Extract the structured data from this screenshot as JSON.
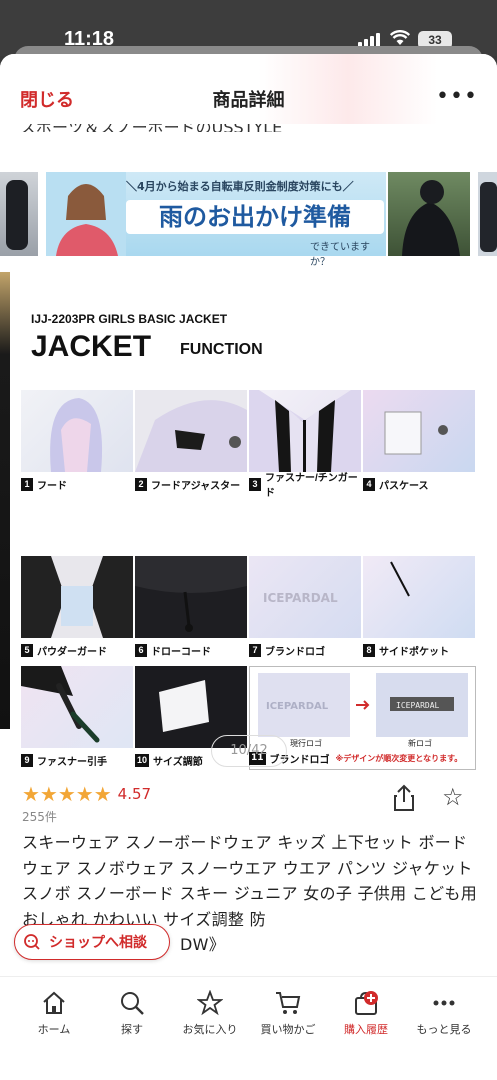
{
  "status": {
    "time": "11:18",
    "battery": "33"
  },
  "header": {
    "close": "閉じる",
    "title": "商品詳細",
    "more": "•••"
  },
  "clipped_text": "スポーツ＆スノーボードのUSSTYLE",
  "rain_banner": {
    "top": "＼4月から始まる自転車反則金制度対策にも／",
    "big": "雨のお出かけ準備",
    "sub": "できていますか？"
  },
  "product_image": {
    "code": "IJJ-2203PR  GIRLS BASIC JACKET",
    "heading": "JACKET",
    "heading_sub": "FUNCTION",
    "features": [
      {
        "num": "1",
        "label": "フード"
      },
      {
        "num": "2",
        "label": "フードアジャスター"
      },
      {
        "num": "3",
        "label": "ファスナー/チンガード"
      },
      {
        "num": "4",
        "label": "パスケース"
      },
      {
        "num": "5",
        "label": "パウダーガード"
      },
      {
        "num": "6",
        "label": "ドローコード"
      },
      {
        "num": "7",
        "label": "ブランドロゴ"
      },
      {
        "num": "8",
        "label": "サイドポケット"
      },
      {
        "num": "9",
        "label": "ファスナー引手"
      },
      {
        "num": "10",
        "label": "サイズ調節"
      },
      {
        "num": "11",
        "label": "ブランドロゴ"
      }
    ],
    "logo_brand": "ICEPARDAL",
    "logo_current": "現行ロゴ",
    "logo_new": "新ロゴ",
    "logo_note": "※デザインが順次変更となります。"
  },
  "pager": "10/42",
  "rating": {
    "stars": "★★★★★",
    "value": "4.57",
    "reviews": "255件"
  },
  "product_title": "スキーウェア スノーボードウェア キッズ  上下セット ボードウェア スノボウェア スノーウエア ウエア パンツ ジャケット スノボ スノーボード スキー ジュニア 女の子 子供用 こども用 おしゃれ かわいい サイズ調整 防",
  "product_title_tail": "DW》",
  "consult_button": "ショップへ相談",
  "tabs": [
    {
      "label": "ホーム",
      "icon": "home-icon"
    },
    {
      "label": "探す",
      "icon": "search-icon"
    },
    {
      "label": "お気に入り",
      "icon": "star-icon"
    },
    {
      "label": "買い物かご",
      "icon": "cart-icon"
    },
    {
      "label": "購入履歴",
      "icon": "history-icon"
    },
    {
      "label": "もっと見る",
      "icon": "more-icon"
    }
  ],
  "colors": {
    "accent": "#d12b2b",
    "star": "#f2a636"
  }
}
